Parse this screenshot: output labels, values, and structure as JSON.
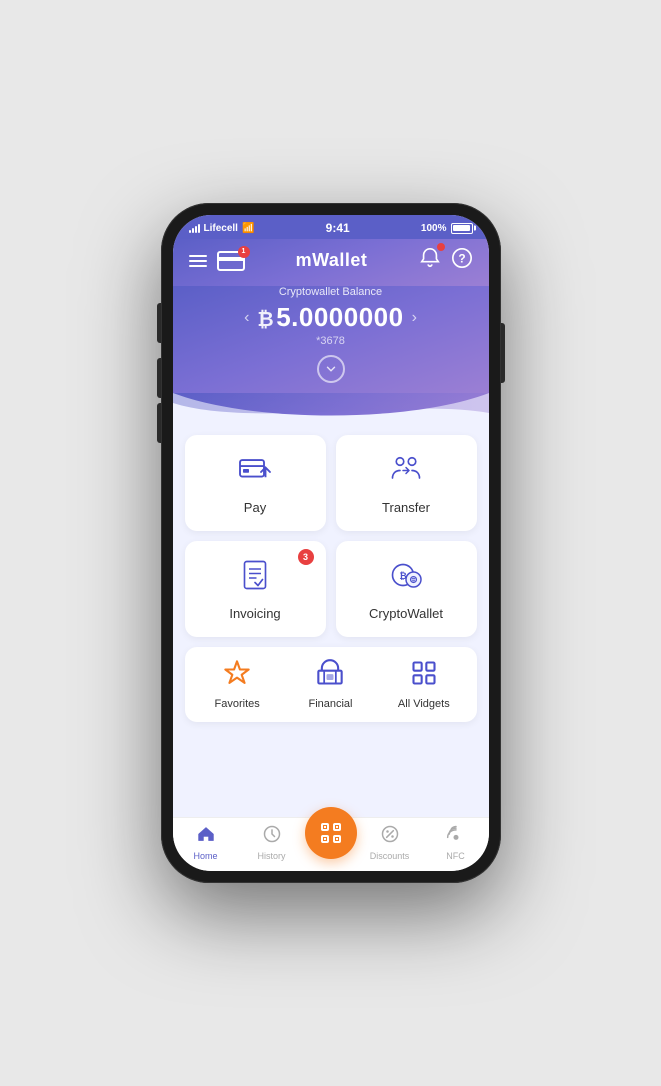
{
  "status_bar": {
    "carrier": "Lifecell",
    "time": "9:41",
    "battery": "100%"
  },
  "header": {
    "title": "mWallet",
    "card_badge": "1"
  },
  "balance": {
    "label": "Cryptowallet Balance",
    "currency_symbol": "₿",
    "amount": "5.0000000",
    "account": "*3678"
  },
  "actions": [
    {
      "id": "pay",
      "label": "Pay",
      "badge": null
    },
    {
      "id": "transfer",
      "label": "Transfer",
      "badge": null
    },
    {
      "id": "invoicing",
      "label": "Invoicing",
      "badge": "3"
    },
    {
      "id": "cryptowallet",
      "label": "CryptoWallet",
      "badge": null
    }
  ],
  "widgets": [
    {
      "id": "favorites",
      "label": "Favorites",
      "icon_type": "star"
    },
    {
      "id": "financial",
      "label": "Financial",
      "icon_type": "bank"
    },
    {
      "id": "all_vidgets",
      "label": "All Vidgets",
      "icon_type": "grid"
    }
  ],
  "nav": [
    {
      "id": "home",
      "label": "Home",
      "active": true
    },
    {
      "id": "history",
      "label": "History",
      "active": false
    },
    {
      "id": "scan",
      "label": "",
      "active": false,
      "center": true
    },
    {
      "id": "discounts",
      "label": "Discounts",
      "active": false
    },
    {
      "id": "nfc",
      "label": "NFC",
      "active": false
    }
  ],
  "colors": {
    "brand_purple": "#5b5fc7",
    "brand_orange": "#f47c20",
    "brand_red": "#e84040",
    "icon_blue": "#4a4fcc"
  }
}
